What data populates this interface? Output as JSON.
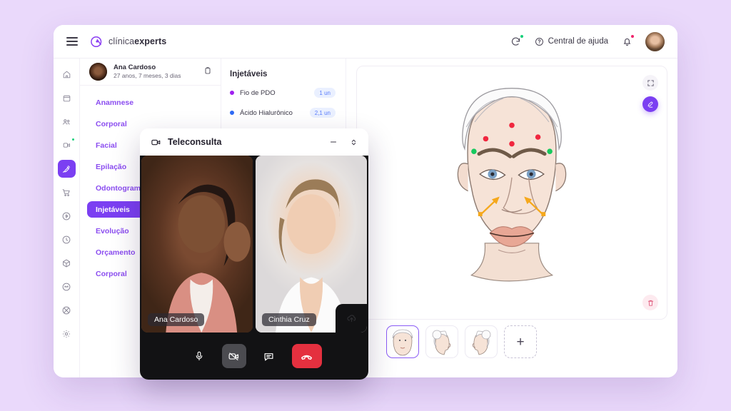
{
  "theme": {
    "page_background": "#ead9fb",
    "accent": "#7b3ff2",
    "accent_text": "#8b4df0",
    "badge_blue": "#5b7dfb",
    "danger": "#e4303f",
    "online_green": "#16d07a"
  },
  "topbar": {
    "menu_icon": "hamburger-icon",
    "brand_light": "clínica",
    "brand_bold": "experts",
    "sync_icon": "refresh-icon",
    "help_icon": "question-circle-icon",
    "help_label": "Central de ajuda",
    "bell_icon": "bell-icon",
    "avatar": "user-avatar"
  },
  "rail": {
    "items": [
      {
        "name": "home-icon",
        "active": false,
        "dot": false
      },
      {
        "name": "calendar-icon",
        "active": false,
        "dot": false
      },
      {
        "name": "users-icon",
        "active": false,
        "dot": false
      },
      {
        "name": "video-call-icon",
        "active": false,
        "dot": true
      },
      {
        "name": "injection-icon",
        "active": true,
        "dot": false
      },
      {
        "name": "cart-icon",
        "active": false,
        "dot": false
      },
      {
        "name": "finance-icon",
        "active": false,
        "dot": false
      },
      {
        "name": "clock-icon",
        "active": false,
        "dot": false
      },
      {
        "name": "box-icon",
        "active": false,
        "dot": false
      },
      {
        "name": "chat-icon",
        "active": false,
        "dot": false
      },
      {
        "name": "marketing-icon",
        "active": false,
        "dot": false
      },
      {
        "name": "settings-icon",
        "active": false,
        "dot": false
      }
    ]
  },
  "patient": {
    "name": "Ana Cardoso",
    "age": "27 anos, 7 meses, 3 dias",
    "clipboard_icon": "clipboard-icon"
  },
  "menu": {
    "items": [
      {
        "label": "Anamnese",
        "active": false
      },
      {
        "label": "Corporal",
        "active": false
      },
      {
        "label": "Facial",
        "active": false
      },
      {
        "label": "Epilação",
        "active": false
      },
      {
        "label": "Odontograma",
        "active": false
      },
      {
        "label": "Injetáveis",
        "active": true
      },
      {
        "label": "Evolução",
        "active": false
      },
      {
        "label": "Orçamento",
        "active": false
      },
      {
        "label": "Corporal",
        "active": false
      }
    ]
  },
  "injectables": {
    "title": "Injetáveis",
    "rows": [
      {
        "label": "Fio de PDO",
        "badge": "1 un",
        "color": "#a020f0"
      },
      {
        "label": "Ácido Hialurônico",
        "badge": "2,1 un",
        "color": "#2f6bf5"
      }
    ]
  },
  "canvas": {
    "expand_icon": "expand-icon",
    "pen_icon": "marker-pen-icon",
    "trash_icon": "trash-icon",
    "markers": {
      "red": 4,
      "green": 2,
      "orange_arrows": 2
    },
    "thumbs": [
      {
        "name": "face-front-thumb",
        "selected": true,
        "add": false
      },
      {
        "name": "face-right-profile-thumb",
        "selected": false,
        "add": false
      },
      {
        "name": "face-left-profile-thumb",
        "selected": false,
        "add": false
      },
      {
        "name": "add-view-thumb",
        "selected": false,
        "add": true,
        "label": "+"
      }
    ]
  },
  "teleconsulta": {
    "icon": "video-camera-icon",
    "title": "Teleconsulta",
    "minimize_icon": "minimize-icon",
    "resize_icon": "resize-icon",
    "participants": [
      {
        "name": "Ana Cardoso"
      },
      {
        "name": "Cinthia Cruz"
      }
    ],
    "share_icon": "screen-share-icon",
    "controls": [
      {
        "name": "microphone-button",
        "icon": "microphone-icon",
        "state": "on"
      },
      {
        "name": "camera-button",
        "icon": "camera-off-icon",
        "state": "off"
      },
      {
        "name": "chat-button",
        "icon": "chat-bubble-icon",
        "state": "on"
      },
      {
        "name": "hangup-button",
        "icon": "phone-hangup-icon",
        "state": "danger"
      }
    ]
  }
}
